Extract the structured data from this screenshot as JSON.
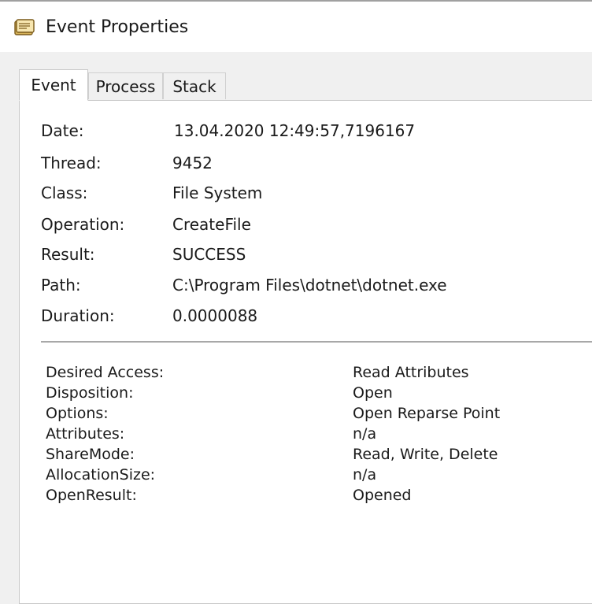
{
  "window": {
    "title": "Event Properties",
    "icon": "event-properties-icon"
  },
  "tabs": [
    {
      "label": "Event",
      "active": true
    },
    {
      "label": "Process",
      "active": false
    },
    {
      "label": "Stack",
      "active": false
    }
  ],
  "event": {
    "properties": [
      {
        "label": "Date:",
        "value": "13.04.2020 12:49:57,7196167"
      },
      {
        "label": "Thread:",
        "value": "9452"
      },
      {
        "label": "Class:",
        "value": "File System"
      },
      {
        "label": "Operation:",
        "value": "CreateFile"
      },
      {
        "label": "Result:",
        "value": "SUCCESS"
      },
      {
        "label": "Path:",
        "value": "C:\\Program Files\\dotnet\\dotnet.exe"
      },
      {
        "label": "Duration:",
        "value": "0.0000088"
      }
    ],
    "details": [
      {
        "label": "Desired Access:",
        "value": "Read Attributes"
      },
      {
        "label": "Disposition:",
        "value": "Open"
      },
      {
        "label": "Options:",
        "value": "Open Reparse Point"
      },
      {
        "label": "Attributes:",
        "value": "n/a"
      },
      {
        "label": "ShareMode:",
        "value": "Read, Write, Delete"
      },
      {
        "label": "AllocationSize:",
        "value": "n/a"
      },
      {
        "label": "OpenResult:",
        "value": "Opened"
      }
    ]
  }
}
